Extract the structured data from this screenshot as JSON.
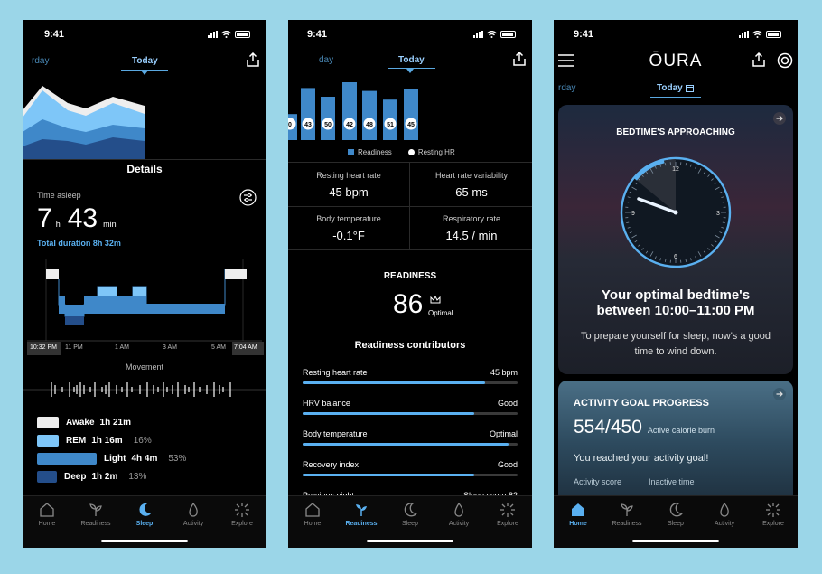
{
  "status_time": "9:41",
  "phone1": {
    "date_prev": "rday",
    "date_current": "Today",
    "details_title": "Details",
    "time_asleep_label": "Time asleep",
    "hours": "7",
    "hours_unit": "h",
    "minutes": "43",
    "minutes_unit": "min",
    "total_duration": "Total duration 8h 32m",
    "time_labels": [
      "10:32 PM",
      "11 PM",
      "1 AM",
      "3 AM",
      "5 AM",
      "7:04 AM"
    ],
    "movement_label": "Movement",
    "stages": [
      {
        "name": "Awake",
        "value": "1h 21m",
        "pct": "",
        "color": "#eeeeee"
      },
      {
        "name": "REM",
        "value": "1h 16m",
        "pct": "16%",
        "color": "#7ec6f8"
      },
      {
        "name": "Light",
        "value": "4h 4m",
        "pct": "53%",
        "color": "#3f88c9"
      },
      {
        "name": "Deep",
        "value": "1h 2m",
        "pct": "13%",
        "color": "#244e8a"
      }
    ]
  },
  "phone2": {
    "date_prev": "day",
    "date_current": "Today",
    "chart_data": {
      "type": "bar",
      "series": [
        {
          "name": "Readiness",
          "values": [
            0,
            43,
            50,
            42,
            48,
            51,
            45
          ]
        },
        {
          "name": "Resting HR",
          "values": [
            0,
            43,
            50,
            42,
            48,
            51,
            45
          ]
        }
      ],
      "point_labels": [
        "0",
        "43",
        "50",
        "42",
        "48",
        "51",
        "45"
      ],
      "bar_heights_rel": [
        0.45,
        0.9,
        0.75,
        1.0,
        0.85,
        0.7,
        0.88
      ]
    },
    "legend": {
      "readiness": "Readiness",
      "resting_hr": "Resting HR"
    },
    "metrics": [
      {
        "title": "Resting heart rate",
        "value": "45 bpm"
      },
      {
        "title": "Heart rate variability",
        "value": "65 ms"
      },
      {
        "title": "Body temperature",
        "value": "-0.1°F"
      },
      {
        "title": "Respiratory rate",
        "value": "14.5 / min"
      }
    ],
    "readiness_label": "READINESS",
    "readiness_score": "86",
    "readiness_status": "Optimal",
    "contributors_title": "Readiness contributors",
    "contributors": [
      {
        "name": "Resting heart rate",
        "status": "45 bpm",
        "fill": 0.85
      },
      {
        "name": "HRV balance",
        "status": "Good",
        "fill": 0.8
      },
      {
        "name": "Body temperature",
        "status": "Optimal",
        "fill": 0.96
      },
      {
        "name": "Recovery index",
        "status": "Good",
        "fill": 0.8
      },
      {
        "name": "Previous night",
        "status": "Sleep score 82",
        "fill": 0.8
      }
    ]
  },
  "phone3": {
    "logo": "ŌURA",
    "date_prev": "rday",
    "date_current": "Today",
    "bedtime_card": {
      "title": "BEDTIME'S APPROACHING",
      "clock_numbers": [
        "12",
        "3",
        "6",
        "9"
      ],
      "headline": "Your optimal bedtime's between 10:00–11:00 PM",
      "body": "To prepare yourself for sleep, now's a good time to wind down."
    },
    "activity_card": {
      "title": "ACTIVITY GOAL PROGRESS",
      "value": "554/450",
      "unit": "Active calorie burn",
      "message": "You reached your activity goal!",
      "footer_left": "Activity score",
      "footer_right": "Inactive time"
    }
  },
  "tabs": [
    "Home",
    "Readiness",
    "Sleep",
    "Activity",
    "Explore"
  ],
  "colors": {
    "accent": "#5ab0f0",
    "bar": "#3f88c9",
    "background": "#000000",
    "page": "#9bd6e8"
  },
  "icons": [
    "signal-icon",
    "wifi-icon",
    "battery-icon",
    "share-icon",
    "settings-sliders-icon",
    "menu-icon",
    "ring-icon",
    "calendar-icon",
    "arrow-right-icon",
    "crown-icon",
    "home-icon",
    "readiness-icon",
    "sleep-icon",
    "activity-icon",
    "explore-icon"
  ]
}
